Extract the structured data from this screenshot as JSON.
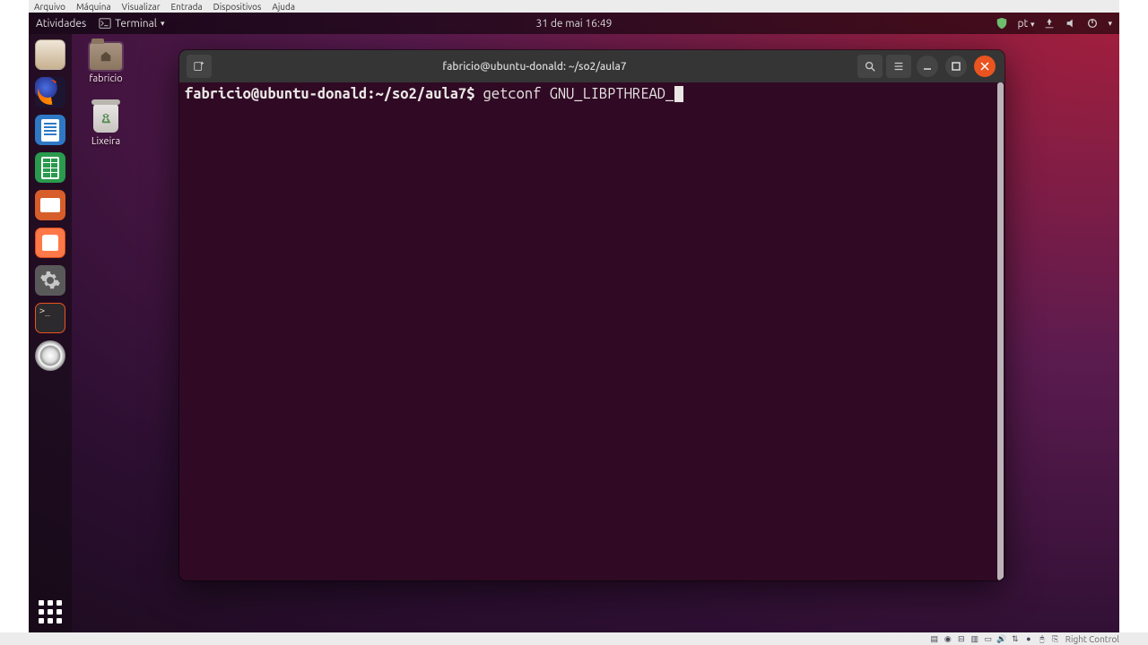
{
  "host_menu": {
    "items": [
      "Arquivo",
      "Máquina",
      "Visualizar",
      "Entrada",
      "Dispositivos",
      "Ajuda"
    ]
  },
  "host_status": {
    "label": "Right Control"
  },
  "topbar": {
    "activities": "Atividades",
    "app_name": "Terminal",
    "datetime": "31 de mai  16:49",
    "lang": "pt"
  },
  "desktop": {
    "home_label": "fabricio",
    "trash_label": "Lixeira"
  },
  "window": {
    "title": "fabricio@ubuntu-donald: ~/so2/aula7"
  },
  "terminal": {
    "prompt_user": "fabricio@ubuntu-donald",
    "prompt_sep1": ":",
    "prompt_path": "~/so2/aula7",
    "prompt_sep2": "$ ",
    "command": "getconf GNU_LIBPTHREAD_"
  }
}
